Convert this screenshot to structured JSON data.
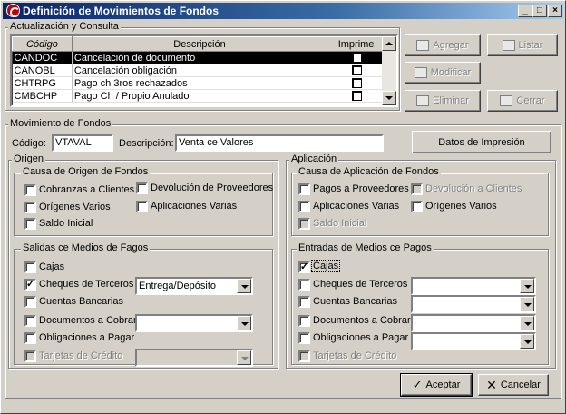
{
  "window": {
    "title": "Definición de Movimientos de Fondos",
    "min_label": "_",
    "max_label": "□",
    "close_label": "×"
  },
  "consulta": {
    "legend": "Actualización y Consulta",
    "columns": [
      "Código",
      "Descripción",
      "Imprime"
    ],
    "rows": [
      {
        "codigo": "CANDOC",
        "descripcion": "Cancelación de documento",
        "imprime": false,
        "selected": true
      },
      {
        "codigo": "CANOBL",
        "descripcion": "Cancelación obligación",
        "imprime": false,
        "selected": false
      },
      {
        "codigo": "CHTRPG",
        "descripcion": "Pago ch 3ros rechazados",
        "imprime": false,
        "selected": false
      },
      {
        "codigo": "CMBCHP",
        "descripcion": "Pago Ch / Propio Anulado",
        "imprime": false,
        "selected": false
      }
    ],
    "buttons": {
      "agregar": "Agregar",
      "listar": "Listar",
      "modificar": "Modificar",
      "eliminar": "Eliminar",
      "cerrar": "Cerrar"
    }
  },
  "movimiento": {
    "legend": "Movimiento de Fondos",
    "codigo_label": "Código:",
    "codigo_value": "VTAVAL",
    "descripcion_label": "Descripción:",
    "descripcion_value": "Venta ce Valores",
    "datos_impresion": "Datos de Impresión"
  },
  "origen": {
    "legend": "Origen",
    "causa_legend": "Causa de Origen de Fondos",
    "causa": {
      "cobranzas": "Cobranzas a Clientes",
      "devolucion": "Devolución de Proveedores",
      "origenes": "Orígenes Varios",
      "aplicaciones": "Aplicaciones Varias",
      "saldo": "Saldo Inicial"
    },
    "salidas_legend": "Salidas ce Medios de Fagos",
    "salidas": {
      "cajas": "Cajas",
      "cheques": "Cheques de Terceros",
      "cheques_combo": "Entrega/Depósito",
      "cuentas": "Cuentas Bancarias",
      "documentos": "Documentos a Cobrar",
      "obligaciones": "Obligaciones a Pagar",
      "tarjetas": "Tarjetas de Crédito"
    }
  },
  "aplicacion": {
    "legend": "Aplicación",
    "causa_legend": "Causa de Aplicación de Fondos",
    "causa": {
      "pagos": "Pagos a Proveedores",
      "devolucion": "Devolución a Clientes",
      "aplicaciones": "Aplicaciones Varias",
      "origenes": "Orígenes Varios",
      "saldo": "Saldo Inicial"
    },
    "entradas_legend": "Entradas de Medios ce Pagos",
    "entradas": {
      "cajas": "Cajas",
      "cheques": "Cheques de Terceros",
      "cuentas": "Cuentas Bancarias",
      "documentos": "Documentos a Cobrar",
      "obligaciones": "Obligaciones a Pagar",
      "tarjetas": "Tarjetas de Crédito"
    }
  },
  "footer": {
    "aceptar": "Aceptar",
    "cancelar": "Cancelar"
  },
  "checkmark": "✓"
}
